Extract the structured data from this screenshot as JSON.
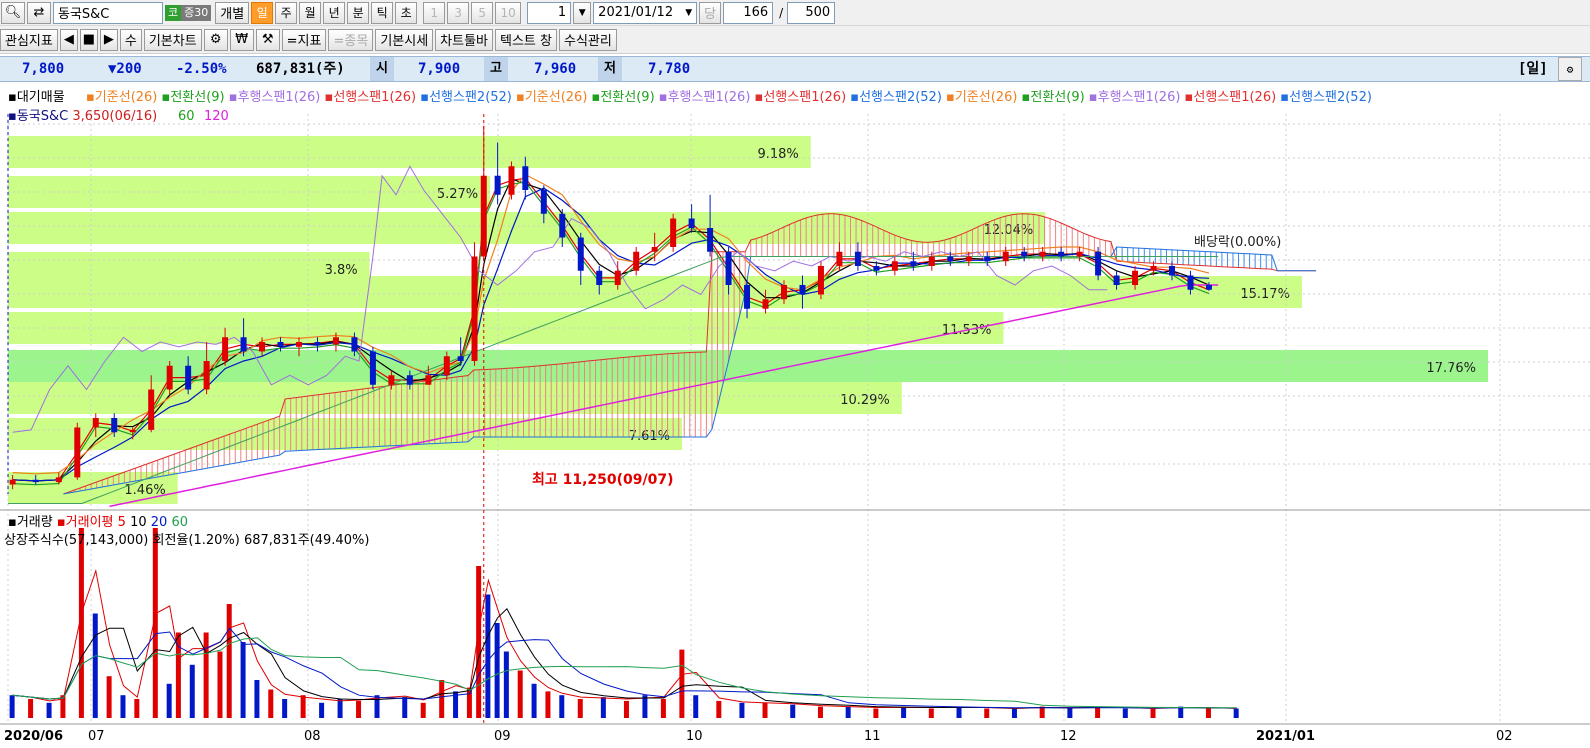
{
  "colors": {
    "up": "#e00000",
    "down": "#0018c8",
    "band": "#ccfd86",
    "band_max": "#9cf58c",
    "ma120": "#e020e0",
    "grid": "#cfcfcf",
    "cloud_up": "#f08080",
    "cloud_down": "#3c8ce6"
  },
  "toolbar": {
    "search_icon": "search-icon",
    "swap_icon": "swap-icon",
    "stock_name": "동국S&C",
    "market_badge": "코",
    "weight_badge": "증30",
    "individual_btn": "개별",
    "periods": [
      "일",
      "주",
      "월",
      "년",
      "분",
      "틱",
      "초"
    ],
    "active_period": "일",
    "minute_nums": [
      "1",
      "3",
      "5",
      "10"
    ],
    "interval_value": "1",
    "date_value": "2021/01/12",
    "dang_label": "당",
    "count_value": "166",
    "slash": "/",
    "total_value": "500"
  },
  "toolbar2": {
    "watch_label": "관심지표",
    "su_label": "수",
    "basic_chart": "기본차트",
    "indicator_btn": "=지표",
    "stock_btn": "=종목",
    "basic_quote": "기본시세",
    "chart_toolbar": "차트툴바",
    "text_window": "텍스트 창",
    "formula_mgmt": "수식관리",
    "won_symbol": "₩"
  },
  "info": {
    "price": "7,800",
    "change": "▼200",
    "change_pct": "-2.50%",
    "volume": "687,831(주)",
    "open_label": "시",
    "open": "7,900",
    "high_label": "고",
    "high": "7,960",
    "low_label": "저",
    "low": "7,780",
    "period_badge": "[일]"
  },
  "legend": {
    "prefix": "대기매물",
    "items": [
      {
        "label": "기준선(26)",
        "color": "#f08020"
      },
      {
        "label": "전환선(9)",
        "color": "#20a020"
      },
      {
        "label": "후행스팬1(26)",
        "color": "#a070e0"
      },
      {
        "label": "선행스팬1(26)",
        "color": "#e03030"
      },
      {
        "label": "선행스팬2(52)",
        "color": "#2070e0"
      },
      {
        "label": "기준선(26)",
        "color": "#f08020"
      },
      {
        "label": "전환선(9)",
        "color": "#20a020"
      },
      {
        "label": "후행스팬1(26)",
        "color": "#a070e0"
      },
      {
        "label": "선행스팬1(26)",
        "color": "#e03030"
      },
      {
        "label": "선행스팬2(52)",
        "color": "#2070e0"
      },
      {
        "label": "기준선(26)",
        "color": "#f08020"
      },
      {
        "label": "전환선(9)",
        "color": "#20a020"
      },
      {
        "label": "후행스팬1(26)",
        "color": "#a070e0"
      },
      {
        "label": "선행스팬1(26)",
        "color": "#e03030"
      },
      {
        "label": "선행스팬2(52)",
        "color": "#2070e0"
      }
    ],
    "line2_name": "동국S&C",
    "line2_price": "3,650(06/16)",
    "ma_periods": [
      "60",
      "120"
    ]
  },
  "volume_panel": {
    "title": "거래량",
    "avg_label": "거래이평",
    "avg_periods": [
      "5",
      "10",
      "20",
      "60"
    ],
    "avg_colors": [
      "#e00000",
      "#000000",
      "#0018c8",
      "#20a050"
    ],
    "shares_info": "상장주식수(57,143,000) 회전율(1.20%) 687,831주(49.40%)"
  },
  "chart_data": {
    "type": "candlestick",
    "x_ticks": [
      "2020/06",
      "07",
      "08",
      "09",
      "10",
      "11",
      "12",
      "2021/01",
      "02"
    ],
    "bands": [
      {
        "label": "1.46%",
        "pct": 1.46
      },
      {
        "label": "7.61%",
        "pct": 7.61
      },
      {
        "label": "10.29%",
        "pct": 10.29
      },
      {
        "label": "17.76%",
        "pct": 17.76
      },
      {
        "label": "11.53%",
        "pct": 11.53
      },
      {
        "label": "15.17%",
        "pct": 15.17
      },
      {
        "label": "12.04%",
        "pct": 12.04
      },
      {
        "label": "5.27%",
        "pct": 5.27
      },
      {
        "label": "9.18%",
        "pct": 9.18
      },
      {
        "label": "3.8%",
        "pct": 3.8
      }
    ],
    "annotations": {
      "high": "최고 11,250(09/07)",
      "dividend": "배당락(0.00%)"
    },
    "price_range": [
      3500,
      11500
    ],
    "volume_bars": [
      {
        "m": 0.05,
        "v": 12,
        "up": false
      },
      {
        "m": 0.25,
        "v": 10,
        "up": true
      },
      {
        "m": 0.45,
        "v": 8,
        "up": false
      },
      {
        "m": 0.6,
        "v": 12,
        "up": true
      },
      {
        "m": 0.8,
        "v": 100,
        "up": true
      },
      {
        "m": 0.95,
        "v": 55,
        "up": false
      },
      {
        "m": 1.1,
        "v": 22,
        "up": true
      },
      {
        "m": 1.25,
        "v": 12,
        "up": false
      },
      {
        "m": 1.4,
        "v": 10,
        "up": true
      },
      {
        "m": 1.6,
        "v": 100,
        "up": true
      },
      {
        "m": 1.75,
        "v": 18,
        "up": false
      },
      {
        "m": 1.85,
        "v": 45,
        "up": true
      },
      {
        "m": 2.0,
        "v": 28,
        "up": false
      },
      {
        "m": 2.15,
        "v": 45,
        "up": true
      },
      {
        "m": 2.3,
        "v": 35,
        "up": true
      },
      {
        "m": 2.4,
        "v": 60,
        "up": true
      },
      {
        "m": 2.55,
        "v": 40,
        "up": false
      },
      {
        "m": 2.7,
        "v": 20,
        "up": false
      },
      {
        "m": 2.85,
        "v": 15,
        "up": true
      },
      {
        "m": 3.0,
        "v": 10,
        "up": false
      },
      {
        "m": 3.2,
        "v": 12,
        "up": true
      },
      {
        "m": 3.4,
        "v": 8,
        "up": false
      },
      {
        "m": 3.6,
        "v": 10,
        "up": false
      },
      {
        "m": 3.8,
        "v": 9,
        "up": true
      },
      {
        "m": 4.0,
        "v": 12,
        "up": false
      },
      {
        "m": 4.3,
        "v": 11,
        "up": false
      },
      {
        "m": 4.5,
        "v": 8,
        "up": true
      },
      {
        "m": 4.7,
        "v": 20,
        "up": true
      },
      {
        "m": 4.85,
        "v": 14,
        "up": false
      },
      {
        "m": 5.0,
        "v": 16,
        "up": true
      },
      {
        "m": 5.1,
        "v": 80,
        "up": true
      },
      {
        "m": 5.2,
        "v": 65,
        "up": false
      },
      {
        "m": 5.3,
        "v": 50,
        "up": false
      },
      {
        "m": 5.4,
        "v": 35,
        "up": false
      },
      {
        "m": 5.55,
        "v": 25,
        "up": true
      },
      {
        "m": 5.7,
        "v": 18,
        "up": false
      },
      {
        "m": 5.85,
        "v": 14,
        "up": true
      },
      {
        "m": 6.0,
        "v": 12,
        "up": false
      },
      {
        "m": 6.2,
        "v": 10,
        "up": true
      },
      {
        "m": 6.45,
        "v": 11,
        "up": false
      },
      {
        "m": 6.7,
        "v": 9,
        "up": true
      },
      {
        "m": 6.9,
        "v": 12,
        "up": false
      },
      {
        "m": 7.1,
        "v": 10,
        "up": true
      },
      {
        "m": 7.3,
        "v": 36,
        "up": true
      },
      {
        "m": 7.45,
        "v": 12,
        "up": false
      },
      {
        "m": 7.7,
        "v": 9,
        "up": true
      },
      {
        "m": 7.95,
        "v": 8,
        "up": false
      },
      {
        "m": 8.2,
        "v": 8,
        "up": true
      },
      {
        "m": 8.5,
        "v": 7,
        "up": false
      },
      {
        "m": 8.8,
        "v": 6,
        "up": true
      },
      {
        "m": 9.1,
        "v": 6,
        "up": false
      },
      {
        "m": 9.4,
        "v": 5,
        "up": true
      },
      {
        "m": 9.7,
        "v": 6,
        "up": false
      },
      {
        "m": 10.0,
        "v": 5,
        "up": true
      },
      {
        "m": 10.3,
        "v": 6,
        "up": false
      },
      {
        "m": 10.6,
        "v": 5,
        "up": true
      },
      {
        "m": 10.9,
        "v": 5,
        "up": false
      },
      {
        "m": 11.2,
        "v": 6,
        "up": true
      },
      {
        "m": 11.5,
        "v": 5,
        "up": false
      },
      {
        "m": 11.8,
        "v": 6,
        "up": true
      },
      {
        "m": 12.1,
        "v": 5,
        "up": false
      },
      {
        "m": 12.4,
        "v": 5,
        "up": true
      },
      {
        "m": 12.7,
        "v": 6,
        "up": false
      },
      {
        "m": 13.0,
        "v": 5,
        "up": true
      },
      {
        "m": 13.3,
        "v": 5,
        "up": false
      }
    ],
    "candles": [
      {
        "m": 0.05,
        "o": 3700,
        "c": 3800,
        "h": 3900,
        "l": 3600
      },
      {
        "m": 0.3,
        "o": 3800,
        "c": 3750,
        "h": 3900,
        "l": 3700
      },
      {
        "m": 0.55,
        "o": 3750,
        "c": 3850,
        "h": 3950,
        "l": 3700
      },
      {
        "m": 0.75,
        "o": 3850,
        "c": 4900,
        "h": 5000,
        "l": 3800
      },
      {
        "m": 0.95,
        "o": 4900,
        "c": 5100,
        "h": 5200,
        "l": 4700
      },
      {
        "m": 1.15,
        "o": 5100,
        "c": 4800,
        "h": 5200,
        "l": 4700
      },
      {
        "m": 1.35,
        "o": 4800,
        "c": 4850,
        "h": 4900,
        "l": 4650
      },
      {
        "m": 1.55,
        "o": 4850,
        "c": 5700,
        "h": 6000,
        "l": 4800
      },
      {
        "m": 1.75,
        "o": 5700,
        "c": 6200,
        "h": 6300,
        "l": 5600
      },
      {
        "m": 1.95,
        "o": 6200,
        "c": 5700,
        "h": 6400,
        "l": 5600
      },
      {
        "m": 2.15,
        "o": 5700,
        "c": 6300,
        "h": 6700,
        "l": 5600
      },
      {
        "m": 2.35,
        "o": 6300,
        "c": 6800,
        "h": 7000,
        "l": 6200
      },
      {
        "m": 2.55,
        "o": 6800,
        "c": 6500,
        "h": 7200,
        "l": 6400
      },
      {
        "m": 2.75,
        "o": 6500,
        "c": 6700,
        "h": 6800,
        "l": 6400
      },
      {
        "m": 2.95,
        "o": 6700,
        "c": 6600,
        "h": 6800,
        "l": 6500
      },
      {
        "m": 3.15,
        "o": 6600,
        "c": 6700,
        "h": 6800,
        "l": 6400
      },
      {
        "m": 3.35,
        "o": 6700,
        "c": 6650,
        "h": 6800,
        "l": 6500
      },
      {
        "m": 3.55,
        "o": 6650,
        "c": 6800,
        "h": 6900,
        "l": 6500
      },
      {
        "m": 3.75,
        "o": 6800,
        "c": 6500,
        "h": 6900,
        "l": 6400
      },
      {
        "m": 3.95,
        "o": 6500,
        "c": 5800,
        "h": 6600,
        "l": 5700
      },
      {
        "m": 4.15,
        "o": 5800,
        "c": 6000,
        "h": 6100,
        "l": 5700
      },
      {
        "m": 4.35,
        "o": 6000,
        "c": 5800,
        "h": 6100,
        "l": 5700
      },
      {
        "m": 4.55,
        "o": 5800,
        "c": 6000,
        "h": 6200,
        "l": 5800
      },
      {
        "m": 4.75,
        "o": 6000,
        "c": 6400,
        "h": 6500,
        "l": 5900
      },
      {
        "m": 4.9,
        "o": 6400,
        "c": 6300,
        "h": 6800,
        "l": 6200
      },
      {
        "m": 5.05,
        "o": 6300,
        "c": 8500,
        "h": 8800,
        "l": 6200
      },
      {
        "m": 5.15,
        "o": 8500,
        "c": 10200,
        "h": 11250,
        "l": 8400
      },
      {
        "m": 5.3,
        "o": 10200,
        "c": 9800,
        "h": 10900,
        "l": 9600
      },
      {
        "m": 5.45,
        "o": 9800,
        "c": 10400,
        "h": 10500,
        "l": 9700
      },
      {
        "m": 5.6,
        "o": 10400,
        "c": 9900,
        "h": 10600,
        "l": 9700
      },
      {
        "m": 5.8,
        "o": 9900,
        "c": 9400,
        "h": 10000,
        "l": 9200
      },
      {
        "m": 6.0,
        "o": 9400,
        "c": 8900,
        "h": 9500,
        "l": 8700
      },
      {
        "m": 6.2,
        "o": 8900,
        "c": 8200,
        "h": 9000,
        "l": 7900
      },
      {
        "m": 6.4,
        "o": 8200,
        "c": 7900,
        "h": 8300,
        "l": 7700
      },
      {
        "m": 6.6,
        "o": 7900,
        "c": 8200,
        "h": 8400,
        "l": 7800
      },
      {
        "m": 6.8,
        "o": 8200,
        "c": 8600,
        "h": 8700,
        "l": 8100
      },
      {
        "m": 7.0,
        "o": 8600,
        "c": 8700,
        "h": 9000,
        "l": 8400
      },
      {
        "m": 7.2,
        "o": 8700,
        "c": 9300,
        "h": 9400,
        "l": 8600
      },
      {
        "m": 7.4,
        "o": 9300,
        "c": 9100,
        "h": 9600,
        "l": 9000
      },
      {
        "m": 7.6,
        "o": 9100,
        "c": 8600,
        "h": 9800,
        "l": 8500
      },
      {
        "m": 7.8,
        "o": 8600,
        "c": 7900,
        "h": 8700,
        "l": 7700
      },
      {
        "m": 8.0,
        "o": 7900,
        "c": 7400,
        "h": 8000,
        "l": 7200
      },
      {
        "m": 8.2,
        "o": 7400,
        "c": 7600,
        "h": 7800,
        "l": 7300
      },
      {
        "m": 8.4,
        "o": 7600,
        "c": 7900,
        "h": 8000,
        "l": 7500
      },
      {
        "m": 8.6,
        "o": 7900,
        "c": 7700,
        "h": 8100,
        "l": 7400
      },
      {
        "m": 8.8,
        "o": 7700,
        "c": 8300,
        "h": 8400,
        "l": 7600
      },
      {
        "m": 9.0,
        "o": 8300,
        "c": 8600,
        "h": 8800,
        "l": 8200
      },
      {
        "m": 9.2,
        "o": 8600,
        "c": 8300,
        "h": 8800,
        "l": 8200
      },
      {
        "m": 9.4,
        "o": 8300,
        "c": 8200,
        "h": 8400,
        "l": 8100
      },
      {
        "m": 9.6,
        "o": 8200,
        "c": 8400,
        "h": 8500,
        "l": 8100
      },
      {
        "m": 9.8,
        "o": 8400,
        "c": 8300,
        "h": 8600,
        "l": 8200
      },
      {
        "m": 10.0,
        "o": 8300,
        "c": 8500,
        "h": 8600,
        "l": 8200
      },
      {
        "m": 10.2,
        "o": 8500,
        "c": 8400,
        "h": 8600,
        "l": 8300
      },
      {
        "m": 10.4,
        "o": 8400,
        "c": 8500,
        "h": 8600,
        "l": 8300
      },
      {
        "m": 10.6,
        "o": 8500,
        "c": 8400,
        "h": 8600,
        "l": 8300
      },
      {
        "m": 10.8,
        "o": 8400,
        "c": 8600,
        "h": 8700,
        "l": 8300
      },
      {
        "m": 11.0,
        "o": 8600,
        "c": 8500,
        "h": 8700,
        "l": 8400
      },
      {
        "m": 11.2,
        "o": 8500,
        "c": 8600,
        "h": 8700,
        "l": 8400
      },
      {
        "m": 11.4,
        "o": 8600,
        "c": 8500,
        "h": 8700,
        "l": 8400
      },
      {
        "m": 11.6,
        "o": 8500,
        "c": 8600,
        "h": 8700,
        "l": 8400
      },
      {
        "m": 11.8,
        "o": 8600,
        "c": 8100,
        "h": 8700,
        "l": 8000
      },
      {
        "m": 12.0,
        "o": 8100,
        "c": 7900,
        "h": 8200,
        "l": 7800
      },
      {
        "m": 12.2,
        "o": 7900,
        "c": 8200,
        "h": 8300,
        "l": 7800
      },
      {
        "m": 12.4,
        "o": 8200,
        "c": 8300,
        "h": 8400,
        "l": 8100
      },
      {
        "m": 12.6,
        "o": 8300,
        "c": 8100,
        "h": 8400,
        "l": 8000
      },
      {
        "m": 12.8,
        "o": 8100,
        "c": 7800,
        "h": 8200,
        "l": 7700
      },
      {
        "m": 13.0,
        "o": 7900,
        "c": 7800,
        "h": 7960,
        "l": 7780
      }
    ]
  }
}
